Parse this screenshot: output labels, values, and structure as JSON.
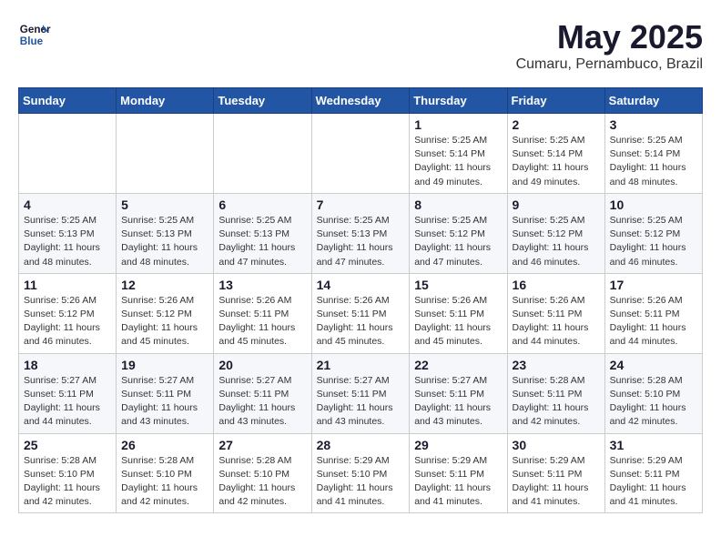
{
  "header": {
    "logo_line1": "General",
    "logo_line2": "Blue",
    "month": "May 2025",
    "location": "Cumaru, Pernambuco, Brazil"
  },
  "days_of_week": [
    "Sunday",
    "Monday",
    "Tuesday",
    "Wednesday",
    "Thursday",
    "Friday",
    "Saturday"
  ],
  "weeks": [
    [
      {
        "day": "",
        "info": ""
      },
      {
        "day": "",
        "info": ""
      },
      {
        "day": "",
        "info": ""
      },
      {
        "day": "",
        "info": ""
      },
      {
        "day": "1",
        "info": "Sunrise: 5:25 AM\nSunset: 5:14 PM\nDaylight: 11 hours and 49 minutes."
      },
      {
        "day": "2",
        "info": "Sunrise: 5:25 AM\nSunset: 5:14 PM\nDaylight: 11 hours and 49 minutes."
      },
      {
        "day": "3",
        "info": "Sunrise: 5:25 AM\nSunset: 5:14 PM\nDaylight: 11 hours and 48 minutes."
      }
    ],
    [
      {
        "day": "4",
        "info": "Sunrise: 5:25 AM\nSunset: 5:13 PM\nDaylight: 11 hours and 48 minutes."
      },
      {
        "day": "5",
        "info": "Sunrise: 5:25 AM\nSunset: 5:13 PM\nDaylight: 11 hours and 48 minutes."
      },
      {
        "day": "6",
        "info": "Sunrise: 5:25 AM\nSunset: 5:13 PM\nDaylight: 11 hours and 47 minutes."
      },
      {
        "day": "7",
        "info": "Sunrise: 5:25 AM\nSunset: 5:13 PM\nDaylight: 11 hours and 47 minutes."
      },
      {
        "day": "8",
        "info": "Sunrise: 5:25 AM\nSunset: 5:12 PM\nDaylight: 11 hours and 47 minutes."
      },
      {
        "day": "9",
        "info": "Sunrise: 5:25 AM\nSunset: 5:12 PM\nDaylight: 11 hours and 46 minutes."
      },
      {
        "day": "10",
        "info": "Sunrise: 5:25 AM\nSunset: 5:12 PM\nDaylight: 11 hours and 46 minutes."
      }
    ],
    [
      {
        "day": "11",
        "info": "Sunrise: 5:26 AM\nSunset: 5:12 PM\nDaylight: 11 hours and 46 minutes."
      },
      {
        "day": "12",
        "info": "Sunrise: 5:26 AM\nSunset: 5:12 PM\nDaylight: 11 hours and 45 minutes."
      },
      {
        "day": "13",
        "info": "Sunrise: 5:26 AM\nSunset: 5:11 PM\nDaylight: 11 hours and 45 minutes."
      },
      {
        "day": "14",
        "info": "Sunrise: 5:26 AM\nSunset: 5:11 PM\nDaylight: 11 hours and 45 minutes."
      },
      {
        "day": "15",
        "info": "Sunrise: 5:26 AM\nSunset: 5:11 PM\nDaylight: 11 hours and 45 minutes."
      },
      {
        "day": "16",
        "info": "Sunrise: 5:26 AM\nSunset: 5:11 PM\nDaylight: 11 hours and 44 minutes."
      },
      {
        "day": "17",
        "info": "Sunrise: 5:26 AM\nSunset: 5:11 PM\nDaylight: 11 hours and 44 minutes."
      }
    ],
    [
      {
        "day": "18",
        "info": "Sunrise: 5:27 AM\nSunset: 5:11 PM\nDaylight: 11 hours and 44 minutes."
      },
      {
        "day": "19",
        "info": "Sunrise: 5:27 AM\nSunset: 5:11 PM\nDaylight: 11 hours and 43 minutes."
      },
      {
        "day": "20",
        "info": "Sunrise: 5:27 AM\nSunset: 5:11 PM\nDaylight: 11 hours and 43 minutes."
      },
      {
        "day": "21",
        "info": "Sunrise: 5:27 AM\nSunset: 5:11 PM\nDaylight: 11 hours and 43 minutes."
      },
      {
        "day": "22",
        "info": "Sunrise: 5:27 AM\nSunset: 5:11 PM\nDaylight: 11 hours and 43 minutes."
      },
      {
        "day": "23",
        "info": "Sunrise: 5:28 AM\nSunset: 5:11 PM\nDaylight: 11 hours and 42 minutes."
      },
      {
        "day": "24",
        "info": "Sunrise: 5:28 AM\nSunset: 5:10 PM\nDaylight: 11 hours and 42 minutes."
      }
    ],
    [
      {
        "day": "25",
        "info": "Sunrise: 5:28 AM\nSunset: 5:10 PM\nDaylight: 11 hours and 42 minutes."
      },
      {
        "day": "26",
        "info": "Sunrise: 5:28 AM\nSunset: 5:10 PM\nDaylight: 11 hours and 42 minutes."
      },
      {
        "day": "27",
        "info": "Sunrise: 5:28 AM\nSunset: 5:10 PM\nDaylight: 11 hours and 42 minutes."
      },
      {
        "day": "28",
        "info": "Sunrise: 5:29 AM\nSunset: 5:10 PM\nDaylight: 11 hours and 41 minutes."
      },
      {
        "day": "29",
        "info": "Sunrise: 5:29 AM\nSunset: 5:11 PM\nDaylight: 11 hours and 41 minutes."
      },
      {
        "day": "30",
        "info": "Sunrise: 5:29 AM\nSunset: 5:11 PM\nDaylight: 11 hours and 41 minutes."
      },
      {
        "day": "31",
        "info": "Sunrise: 5:29 AM\nSunset: 5:11 PM\nDaylight: 11 hours and 41 minutes."
      }
    ]
  ]
}
